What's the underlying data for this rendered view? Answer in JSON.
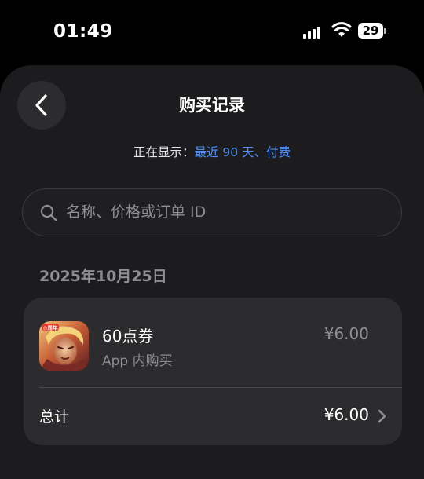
{
  "status_bar": {
    "time": "01:49",
    "battery_level": "29"
  },
  "header": {
    "title": "购买记录",
    "back_icon": "chevron-left-icon"
  },
  "filter": {
    "prefix": "正在显示：",
    "value": "最近 90 天、付费"
  },
  "search": {
    "placeholder": "名称、价格或订单 ID",
    "value": ""
  },
  "purchases": [
    {
      "date": "2025年10月25日",
      "items": [
        {
          "name": "60点券",
          "type": "App 内购买",
          "price": "¥6.00",
          "icon": "game-app-icon"
        }
      ],
      "total_label": "总计",
      "total_value": "¥6.00"
    }
  ],
  "colors": {
    "sheet_background": "#1c1c1e",
    "card_background": "#2c2c2e",
    "accent": "#4a90ff",
    "secondary_text": "#8e8e93"
  }
}
